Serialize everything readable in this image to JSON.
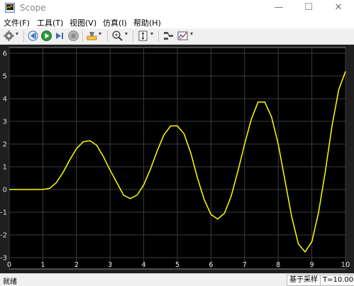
{
  "window": {
    "title": "Scope",
    "minimize": "—",
    "maximize": "☐",
    "close": "✕"
  },
  "menu": [
    "文件(F)",
    "工具(T)",
    "视图(V)",
    "仿真(I)",
    "帮助(H)"
  ],
  "toolbar_icons": [
    "settings-icon",
    "back-icon",
    "run-icon",
    "step-forward-icon",
    "stop-icon",
    "highlight-icon",
    "zoom-icon",
    "autoscale-icon",
    "triggers-icon",
    "measurements-icon"
  ],
  "status": {
    "left": "就绪",
    "mode": "基于采样",
    "time": "T=10.000"
  },
  "colors": {
    "plot_bg": "#1f1f1f",
    "axes_bg": "#000000",
    "grid": "#3c3c3c",
    "axis_text": "#dcdcdc",
    "trace": "#ffff00"
  },
  "chart_data": {
    "type": "line",
    "xlim": [
      0,
      10
    ],
    "ylim": [
      -3.5,
      6.25
    ],
    "xticks": [
      "0",
      "1",
      "2",
      "3",
      "4",
      "5",
      "6",
      "7",
      "8",
      "9",
      "10"
    ],
    "yticks": [
      "-3",
      "-2",
      "-1",
      "0",
      "1",
      "2",
      "3",
      "4",
      "5",
      "6"
    ],
    "grid": true,
    "series": [
      {
        "color": "#ffff00",
        "x": [
          0,
          0.5,
          1.0,
          1.2,
          1.4,
          1.6,
          1.8,
          2.0,
          2.2,
          2.4,
          2.6,
          2.8,
          3.0,
          3.2,
          3.4,
          3.6,
          3.8,
          4.0,
          4.2,
          4.4,
          4.6,
          4.8,
          5.0,
          5.2,
          5.4,
          5.6,
          5.8,
          6.0,
          6.2,
          6.4,
          6.6,
          6.8,
          7.0,
          7.2,
          7.4,
          7.6,
          7.8,
          8.0,
          8.2,
          8.4,
          8.6,
          8.8,
          9.0,
          9.2,
          9.4,
          9.6,
          9.8,
          10.0
        ],
        "y": [
          0,
          0,
          0,
          0.05,
          0.3,
          0.75,
          1.3,
          1.8,
          2.1,
          2.15,
          1.95,
          1.45,
          0.85,
          0.3,
          -0.25,
          -0.4,
          -0.25,
          0.2,
          0.9,
          1.7,
          2.4,
          2.8,
          2.8,
          2.45,
          1.6,
          0.5,
          -0.45,
          -1.1,
          -1.3,
          -1.05,
          -0.3,
          0.8,
          2.0,
          3.1,
          3.85,
          3.85,
          3.2,
          2.0,
          0.4,
          -1.2,
          -2.4,
          -2.75,
          -2.3,
          -1.0,
          0.8,
          2.8,
          4.4,
          5.2
        ]
      }
    ]
  }
}
